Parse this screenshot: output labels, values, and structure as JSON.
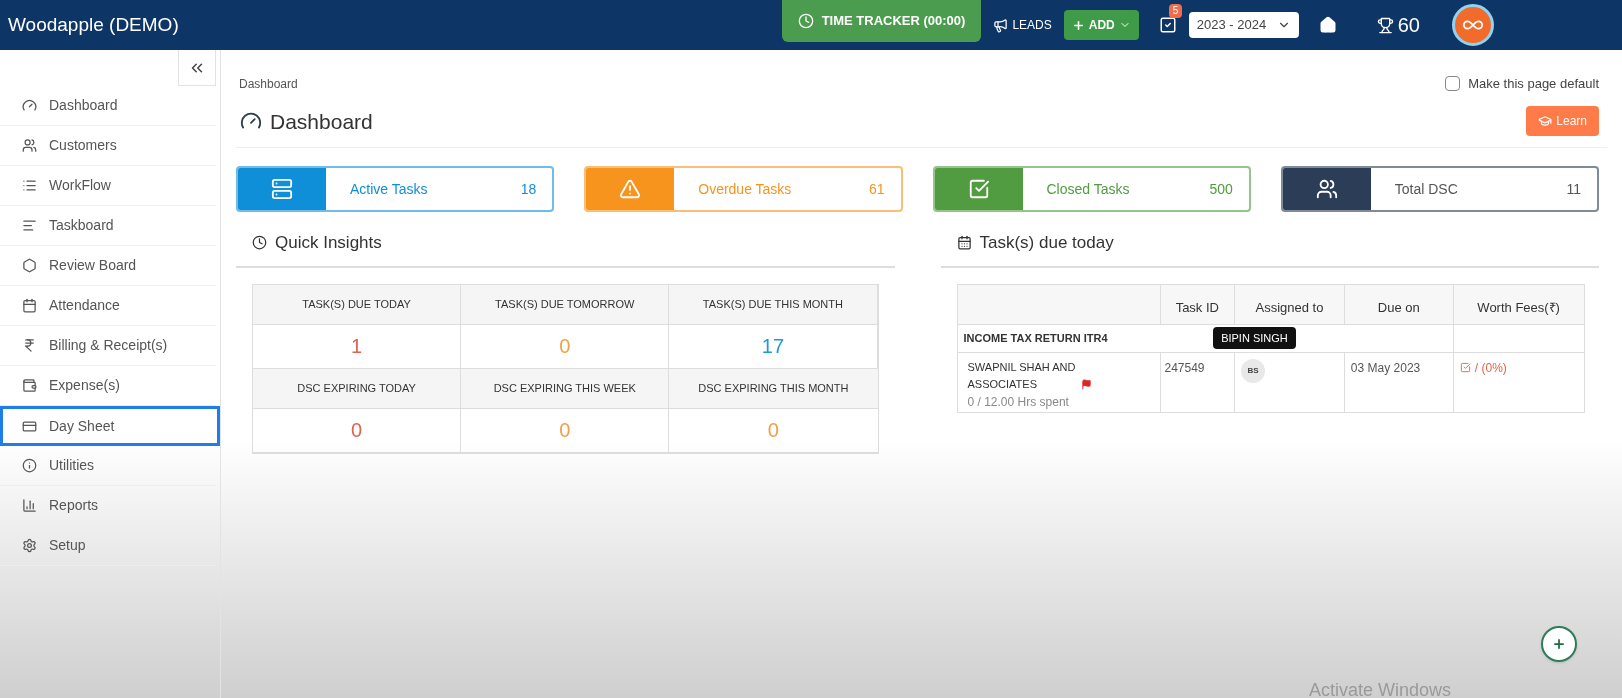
{
  "header": {
    "title": "Woodapple (DEMO)",
    "time_tracker": "TIME TRACKER (00:00)",
    "leads": "LEADS",
    "add": "ADD",
    "task_badge": "5",
    "year": "2023 - 2024",
    "points": "60"
  },
  "sidebar": {
    "items": [
      {
        "label": "Dashboard",
        "highlighted": false
      },
      {
        "label": "Customers",
        "highlighted": false
      },
      {
        "label": "WorkFlow",
        "highlighted": false
      },
      {
        "label": "Taskboard",
        "highlighted": false
      },
      {
        "label": "Review Board",
        "highlighted": false
      },
      {
        "label": "Attendance",
        "highlighted": false
      },
      {
        "label": "Billing & Receipt(s)",
        "highlighted": false
      },
      {
        "label": "Expense(s)",
        "highlighted": false
      },
      {
        "label": "Day Sheet",
        "highlighted": true
      },
      {
        "label": "Utilities",
        "highlighted": false
      },
      {
        "label": "Reports",
        "highlighted": false
      },
      {
        "label": "Setup",
        "highlighted": false
      }
    ]
  },
  "breadcrumb": "Dashboard",
  "make_default": {
    "label": "Make this page default",
    "checked": false
  },
  "page_title": "Dashboard",
  "learn_button": "Learn",
  "stat_cards": [
    {
      "label": "Active Tasks",
      "value": "18",
      "color": "#0f8fd8"
    },
    {
      "label": "Overdue Tasks",
      "value": "61",
      "color": "#f7941d"
    },
    {
      "label": "Closed Tasks",
      "value": "500",
      "color": "#519b40"
    },
    {
      "label": "Total DSC",
      "value": "11",
      "color": "#2c3e57"
    }
  ],
  "quick_insights": {
    "title": "Quick Insights",
    "cells": [
      {
        "label": "TASK(S) DUE TODAY",
        "value": "1",
        "color": "#e0634f"
      },
      {
        "label": "TASK(S) DUE TOMORROW",
        "value": "0",
        "color": "#f0a04b"
      },
      {
        "label": "TASK(S) DUE THIS MONTH",
        "value": "17",
        "color": "#1e9bd6"
      },
      {
        "label": "DSC EXPIRING TODAY",
        "value": "0",
        "color": "#e0634f"
      },
      {
        "label": "DSC EXPIRING THIS WEEK",
        "value": "0",
        "color": "#f0a04b"
      },
      {
        "label": "DSC EXPIRING THIS MONTH",
        "value": "0",
        "color": "#f0a04b"
      }
    ]
  },
  "tasks_due_today": {
    "title": "Task(s) due today",
    "columns": [
      "Task ID",
      "Assigned to",
      "Due on",
      "Worth Fees(₹)"
    ],
    "group": "INCOME TAX RETURN ITR4",
    "rows": [
      {
        "client": "SWAPNIL SHAH AND ASSOCIATES",
        "flagged": true,
        "hours": "0 / 12.00 Hrs spent",
        "task_id": "247549",
        "assignee_initials": "BS",
        "tooltip": "BIPIN SINGH",
        "due_on": "03 May 2023",
        "fees": "/ (0%)"
      }
    ]
  },
  "os_notice": "Activate Windows"
}
